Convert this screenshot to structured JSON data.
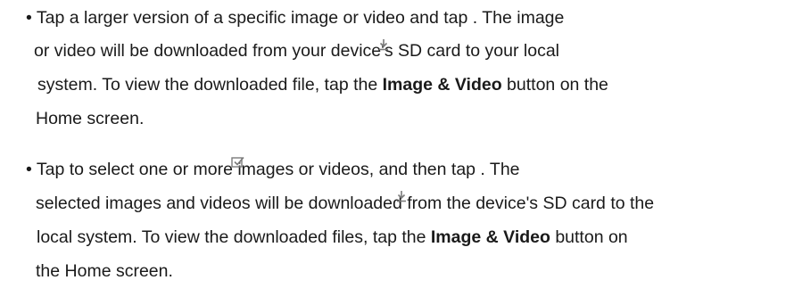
{
  "instructions": [
    {
      "lines": [
        "• Tap a larger version of a specific image or video and tap . The image",
        "or video will be downloaded from your device's SD card to your local",
        [
          "system. To view the downloaded file, tap the ",
          {
            "bold": "Image & Video"
          },
          " button on the"
        ],
        "Home screen."
      ],
      "icon": "download-icon"
    },
    {
      "lines": [
        "• Tap to select one or more images or videos, and then tap . The",
        "selected images and videos will be downloaded from the device's SD card to the",
        [
          "local system. To view the downloaded files, tap the ",
          {
            "bold": "Image & Video"
          },
          " button on"
        ],
        "the Home screen."
      ],
      "icons": [
        "select-checkbox-icon",
        "download-icon"
      ]
    }
  ],
  "colors": {
    "text": "#1a1a1a",
    "icon": "#7a7a7a"
  }
}
